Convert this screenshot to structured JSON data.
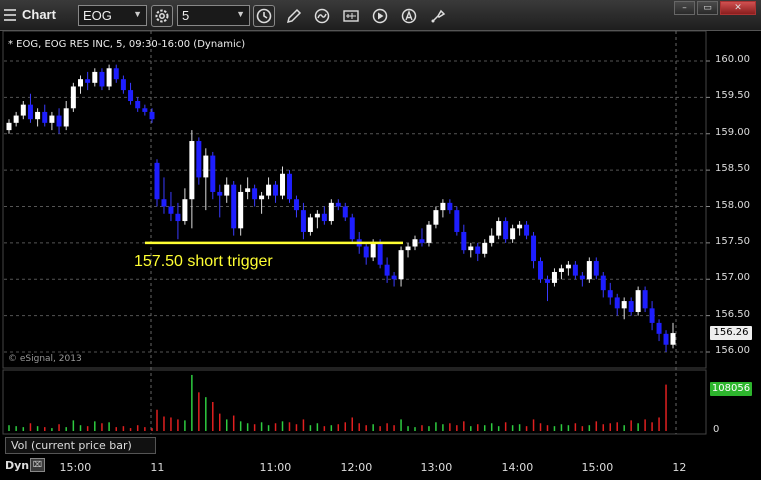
{
  "window": {
    "title": "Chart",
    "symbol": "EOG",
    "interval": "5",
    "symbol_info": "* EOG, EOG RES INC, 5, 09:30-16:00 (Dynamic)",
    "copyright": "© eSignal, 2013",
    "icons": [
      "grip-icon",
      "symbol-dropdown",
      "settings-gear-icon",
      "interval-dropdown",
      "clock-icon",
      "pencil-draw-icon",
      "refresh-curve-icon",
      "quote-ticker-icon",
      "play-replay-icon",
      "alert-a-icon",
      "link-paint-icon",
      "minimize",
      "restore",
      "close"
    ]
  },
  "chart_data": {
    "type": "candlestick",
    "symbol": "EOG",
    "interval_minutes": 5,
    "price_axis": {
      "ticks": [
        "160.00",
        "159.50",
        "159.00",
        "158.50",
        "158.00",
        "157.50",
        "157.00",
        "156.50",
        "156.00"
      ],
      "range": [
        155.9,
        160.3
      ]
    },
    "time_axis": {
      "ticks": [
        "15:00",
        "11",
        "11:00",
        "12:00",
        "13:00",
        "14:00",
        "15:00",
        "12"
      ]
    },
    "last_price": "156.26",
    "annotation": {
      "text": "157.50 short trigger",
      "price": 157.5,
      "color": "#ffff33"
    },
    "up_color": "#ffffff",
    "down_color": "#1e1eff",
    "candles": [
      [
        159.05,
        159.2,
        159.0,
        159.15
      ],
      [
        159.15,
        159.3,
        159.1,
        159.25
      ],
      [
        159.25,
        159.45,
        159.2,
        159.4
      ],
      [
        159.4,
        159.55,
        159.15,
        159.2
      ],
      [
        159.2,
        159.35,
        159.1,
        159.3
      ],
      [
        159.3,
        159.4,
        159.1,
        159.15
      ],
      [
        159.15,
        159.3,
        159.05,
        159.25
      ],
      [
        159.25,
        159.35,
        159.0,
        159.1
      ],
      [
        159.1,
        159.45,
        159.05,
        159.35
      ],
      [
        159.35,
        159.7,
        159.3,
        159.65
      ],
      [
        159.65,
        159.8,
        159.55,
        159.75
      ],
      [
        159.75,
        159.85,
        159.6,
        159.7
      ],
      [
        159.7,
        159.9,
        159.65,
        159.85
      ],
      [
        159.85,
        159.9,
        159.6,
        159.65
      ],
      [
        159.65,
        159.95,
        159.6,
        159.9
      ],
      [
        159.9,
        159.95,
        159.7,
        159.75
      ],
      [
        159.75,
        159.8,
        159.55,
        159.6
      ],
      [
        159.6,
        159.7,
        159.4,
        159.45
      ],
      [
        159.45,
        159.5,
        159.3,
        159.35
      ],
      [
        159.35,
        159.4,
        159.25,
        159.3
      ],
      [
        159.3,
        159.35,
        159.15,
        159.2
      ],
      [
        158.6,
        158.65,
        158.0,
        158.1
      ],
      [
        158.1,
        158.4,
        157.9,
        158.0
      ],
      [
        158.0,
        158.2,
        157.8,
        157.9
      ],
      [
        157.9,
        158.05,
        157.55,
        157.8
      ],
      [
        157.8,
        158.25,
        157.75,
        158.1
      ],
      [
        158.1,
        159.05,
        157.7,
        158.9
      ],
      [
        158.9,
        158.95,
        158.3,
        158.4
      ],
      [
        158.4,
        158.8,
        157.95,
        158.7
      ],
      [
        158.7,
        158.75,
        158.1,
        158.2
      ],
      [
        158.2,
        158.3,
        157.85,
        158.15
      ],
      [
        158.15,
        158.4,
        158.05,
        158.3
      ],
      [
        158.3,
        158.35,
        157.6,
        157.7
      ],
      [
        157.7,
        158.3,
        157.6,
        158.2
      ],
      [
        158.2,
        158.4,
        158.1,
        158.25
      ],
      [
        158.25,
        158.3,
        158.0,
        158.1
      ],
      [
        158.1,
        158.2,
        157.9,
        158.15
      ],
      [
        158.15,
        158.4,
        158.1,
        158.3
      ],
      [
        158.3,
        158.35,
        158.05,
        158.15
      ],
      [
        158.15,
        158.55,
        158.1,
        158.45
      ],
      [
        158.45,
        158.5,
        158.05,
        158.1
      ],
      [
        158.1,
        158.15,
        157.85,
        157.95
      ],
      [
        157.95,
        158.05,
        157.55,
        157.65
      ],
      [
        157.65,
        157.9,
        157.6,
        157.85
      ],
      [
        157.85,
        157.95,
        157.7,
        157.9
      ],
      [
        157.9,
        158.0,
        157.75,
        157.8
      ],
      [
        157.8,
        158.1,
        157.75,
        158.05
      ],
      [
        158.05,
        158.1,
        157.95,
        158.0
      ],
      [
        158.0,
        158.05,
        157.8,
        157.85
      ],
      [
        157.85,
        157.9,
        157.5,
        157.55
      ],
      [
        157.55,
        157.65,
        157.35,
        157.45
      ],
      [
        157.45,
        157.5,
        157.2,
        157.3
      ],
      [
        157.3,
        157.55,
        157.25,
        157.5
      ],
      [
        157.5,
        157.55,
        157.15,
        157.2
      ],
      [
        157.2,
        157.3,
        156.95,
        157.05
      ],
      [
        157.05,
        157.1,
        156.9,
        157.0
      ],
      [
        157.0,
        157.45,
        156.9,
        157.4
      ],
      [
        157.4,
        157.5,
        157.3,
        157.45
      ],
      [
        157.45,
        157.6,
        157.4,
        157.55
      ],
      [
        157.55,
        157.7,
        157.45,
        157.5
      ],
      [
        157.5,
        157.8,
        157.45,
        157.75
      ],
      [
        157.75,
        158.0,
        157.7,
        157.95
      ],
      [
        157.95,
        158.1,
        157.85,
        158.05
      ],
      [
        158.05,
        158.1,
        157.9,
        157.95
      ],
      [
        157.95,
        158.0,
        157.6,
        157.65
      ],
      [
        157.65,
        157.75,
        157.35,
        157.4
      ],
      [
        157.4,
        157.5,
        157.3,
        157.45
      ],
      [
        157.45,
        157.5,
        157.25,
        157.35
      ],
      [
        157.35,
        157.55,
        157.3,
        157.5
      ],
      [
        157.5,
        157.7,
        157.45,
        157.6
      ],
      [
        157.6,
        157.85,
        157.55,
        157.8
      ],
      [
        157.8,
        157.85,
        157.5,
        157.55
      ],
      [
        157.55,
        157.75,
        157.5,
        157.7
      ],
      [
        157.7,
        157.8,
        157.6,
        157.75
      ],
      [
        157.75,
        157.8,
        157.55,
        157.6
      ],
      [
        157.6,
        157.65,
        157.15,
        157.25
      ],
      [
        157.25,
        157.3,
        156.95,
        157.0
      ],
      [
        157.0,
        157.05,
        156.7,
        156.95
      ],
      [
        156.95,
        157.15,
        156.9,
        157.1
      ],
      [
        157.1,
        157.2,
        157.0,
        157.15
      ],
      [
        157.15,
        157.25,
        157.05,
        157.2
      ],
      [
        157.2,
        157.25,
        157.0,
        157.05
      ],
      [
        157.05,
        157.1,
        156.9,
        157.0
      ],
      [
        157.0,
        157.3,
        156.95,
        157.25
      ],
      [
        157.25,
        157.3,
        157.0,
        157.05
      ],
      [
        157.05,
        157.1,
        156.75,
        156.85
      ],
      [
        156.85,
        156.95,
        156.65,
        156.75
      ],
      [
        156.75,
        156.8,
        156.5,
        156.6
      ],
      [
        156.6,
        156.75,
        156.45,
        156.7
      ],
      [
        156.7,
        156.75,
        156.5,
        156.55
      ],
      [
        156.55,
        156.9,
        156.5,
        156.85
      ],
      [
        156.85,
        156.9,
        156.55,
        156.6
      ],
      [
        156.6,
        156.7,
        156.3,
        156.4
      ],
      [
        156.4,
        156.45,
        156.15,
        156.25
      ],
      [
        156.25,
        156.3,
        156.0,
        156.1
      ],
      [
        156.1,
        156.4,
        156.05,
        156.26
      ]
    ],
    "volume_axis": {
      "ticks": [
        "0"
      ]
    },
    "last_volume": "108056",
    "volume_label": "Vol (current price bar)",
    "volumes": [
      6,
      5,
      4,
      8,
      5,
      4,
      3,
      7,
      4,
      11,
      6,
      5,
      10,
      8,
      9,
      4,
      5,
      3,
      6,
      4,
      3,
      22,
      15,
      14,
      12,
      11,
      58,
      40,
      35,
      30,
      18,
      12,
      16,
      10,
      8,
      7,
      9,
      6,
      8,
      10,
      9,
      7,
      12,
      6,
      8,
      5,
      6,
      7,
      9,
      14,
      8,
      6,
      7,
      5,
      8,
      6,
      12,
      5,
      4,
      6,
      5,
      9,
      7,
      8,
      6,
      10,
      5,
      7,
      6,
      8,
      5,
      9,
      6,
      7,
      5,
      12,
      8,
      6,
      5,
      7,
      6,
      8,
      5,
      6,
      10,
      7,
      8,
      9,
      6,
      11,
      8,
      12,
      9,
      14,
      48
    ]
  },
  "footer": {
    "mode": "Dyn"
  }
}
